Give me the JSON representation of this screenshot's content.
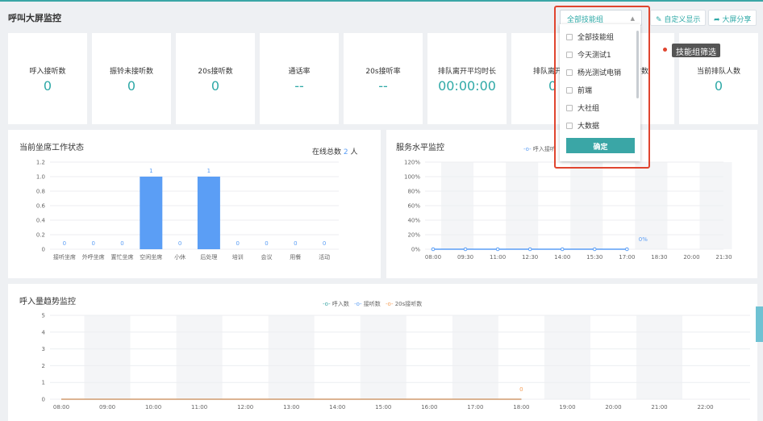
{
  "header": {
    "title": "呼叫大屏监控",
    "skill_select_value": "全部技能组",
    "custom_display_label": "自定义显示",
    "share_label": "大屏分享"
  },
  "kpis": [
    {
      "label": "呼入接听数",
      "value": "0"
    },
    {
      "label": "振铃未接听数",
      "value": "0"
    },
    {
      "label": "20s接听数",
      "value": "0"
    },
    {
      "label": "通话率",
      "value": "--"
    },
    {
      "label": "20s接听率",
      "value": "--"
    },
    {
      "label": "排队离开平均时长",
      "value": "00:00:00"
    },
    {
      "label": "排队离开",
      "value": "0"
    },
    {
      "label": "时数",
      "value": ""
    },
    {
      "label": "当前排队人数",
      "value": "0"
    }
  ],
  "dropdown": {
    "items": [
      "全部技能组",
      "今天测试1",
      "杨光测试电销",
      "前端",
      "大社组",
      "大数据"
    ],
    "confirm_label": "确定"
  },
  "tooltip": "技能组筛选",
  "agent_status": {
    "title": "当前坐席工作状态",
    "online_label": "在线总数",
    "online_count": "2",
    "online_unit": "人"
  },
  "service_level": {
    "title": "服务水平监控",
    "legend": "呼入接听"
  },
  "trend": {
    "title": "呼入量趋势监控",
    "legend": [
      "呼入数",
      "接听数",
      "20s接听数"
    ]
  },
  "chart_data": [
    {
      "type": "bar",
      "categories": [
        "接听坐席",
        "外呼坐席",
        "置忙坐席",
        "空闲坐席",
        "小休",
        "后处理",
        "培训",
        "会议",
        "用餐",
        "活动"
      ],
      "values": [
        0,
        0,
        0,
        1,
        0,
        1,
        0,
        0,
        0,
        0
      ],
      "ylim": [
        0,
        1.2
      ],
      "yticks": [
        "0",
        "0.2",
        "0.4",
        "0.6",
        "0.8",
        "1.0",
        "1.2"
      ],
      "color": "#5b9ef5"
    },
    {
      "type": "line",
      "x": [
        "08:00",
        "09:30",
        "11:00",
        "12:30",
        "14:00",
        "15:30",
        "17:00",
        "18:30",
        "20:00",
        "21:30"
      ],
      "series": [
        {
          "name": "呼入接听",
          "values": [
            0,
            0,
            0,
            0,
            0,
            0,
            0
          ]
        }
      ],
      "point_label": "0%",
      "yticks": [
        "0%",
        "20%",
        "40%",
        "60%",
        "80%",
        "100%",
        "120%"
      ],
      "ylim": [
        0,
        120
      ],
      "color": "#5b9ef5"
    },
    {
      "type": "line",
      "x": [
        "08:00",
        "09:00",
        "10:00",
        "11:00",
        "12:00",
        "13:00",
        "14:00",
        "15:00",
        "16:00",
        "17:00",
        "18:00",
        "19:00",
        "20:00",
        "21:00",
        "22:00"
      ],
      "series": [
        {
          "name": "呼入数",
          "color": "#3aa6a6"
        },
        {
          "name": "接听数",
          "color": "#5b9ef5"
        },
        {
          "name": "20s接听数",
          "color": "#f5a15b"
        }
      ],
      "point_label": "0",
      "yticks": [
        "0",
        "1",
        "2",
        "3",
        "4",
        "5"
      ],
      "ylim": [
        0,
        5
      ]
    }
  ]
}
